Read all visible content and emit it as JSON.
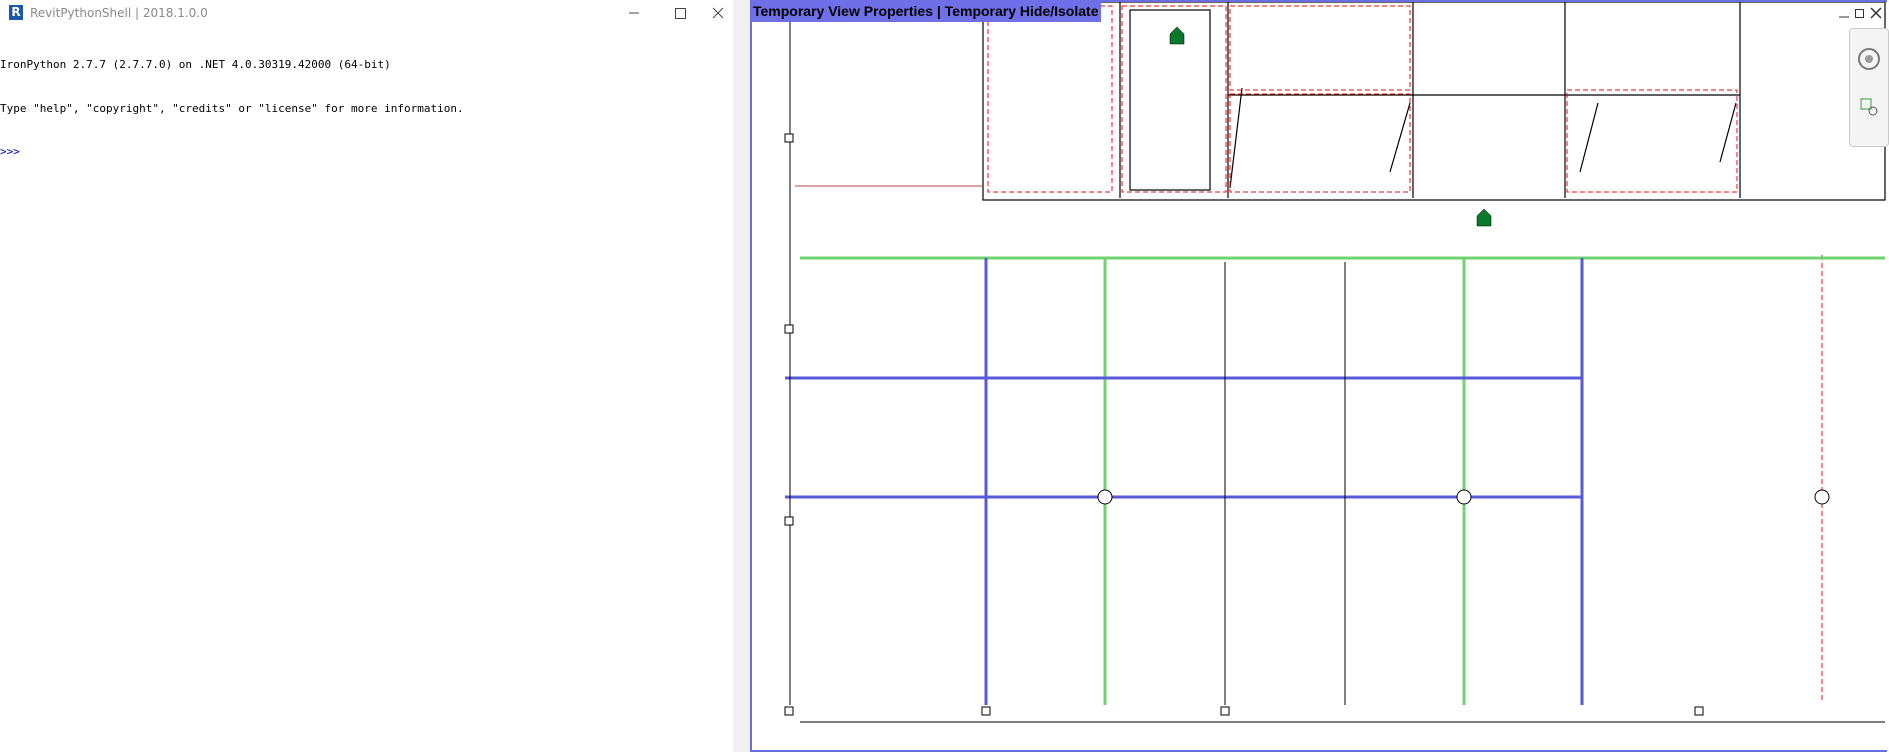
{
  "shell": {
    "title": "RevitPythonShell | 2018.1.0.0",
    "icon": "R",
    "console_lines": [
      "IronPython 2.7.7 (2.7.7.0) on .NET 4.0.30319.42000 (64-bit)",
      "Type \"help\", \"copyright\", \"credits\" or \"license\" for more information."
    ],
    "prompt": ">>>",
    "window_buttons": [
      "minimize-icon",
      "maximize-icon",
      "close-icon"
    ]
  },
  "revit": {
    "view_banner": "Temporary View Properties | Temporary Hide/Isolate",
    "colors": {
      "frame": "#6c6ce4",
      "grid_blue": "#5a5ad8",
      "grid_green": "#6fd46f",
      "room_red": "#e01010",
      "tag_green": "#0a7a2a"
    },
    "controls": [
      "restore-view-icon",
      "tile-view-icon",
      "close-view-icon"
    ],
    "nav_icons": [
      "steering-wheel-icon",
      "zoom-icon"
    ]
  }
}
